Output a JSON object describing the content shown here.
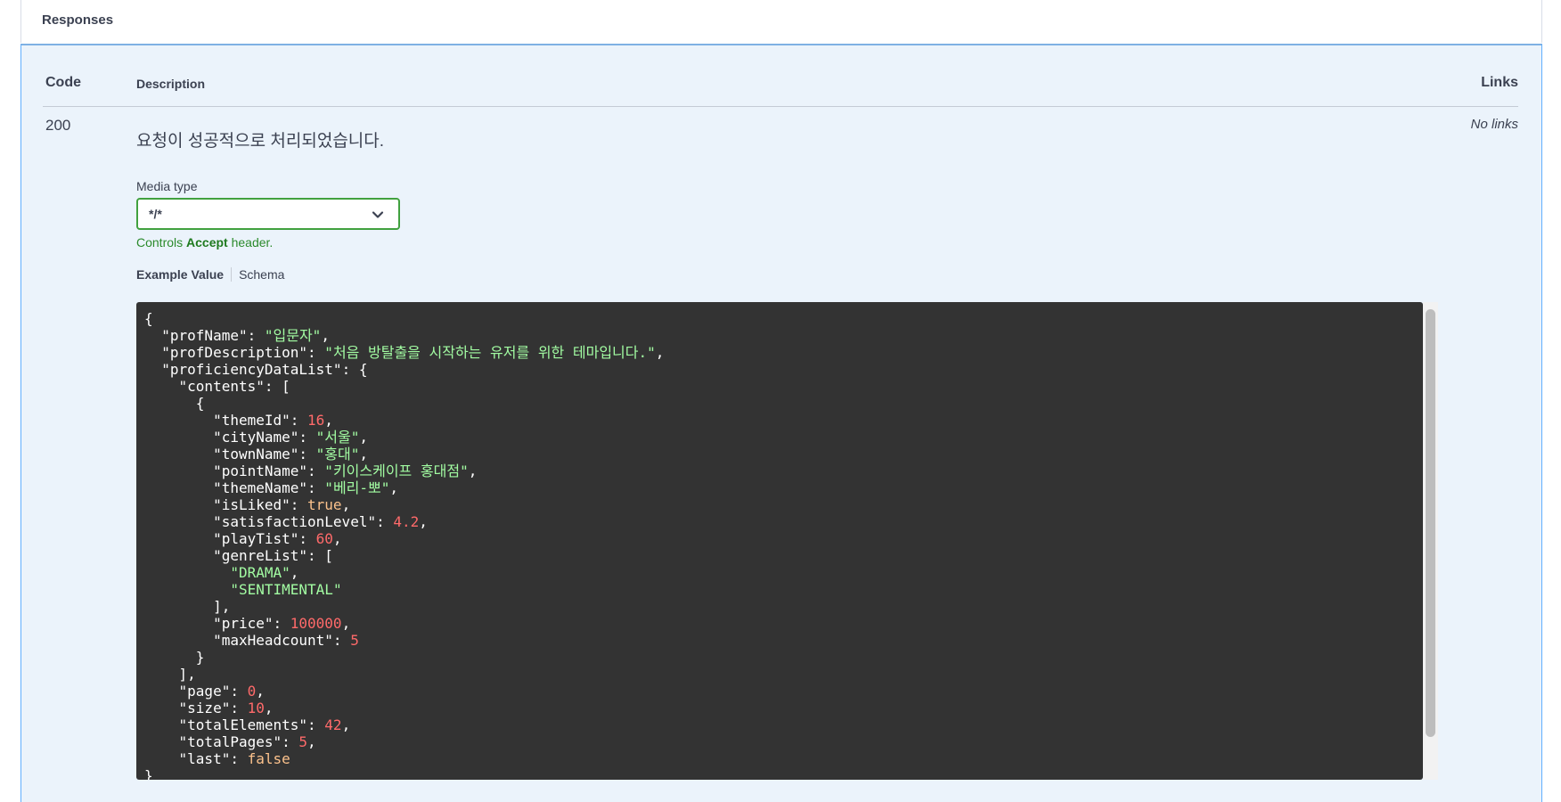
{
  "section": {
    "title": "Responses"
  },
  "table": {
    "headers": {
      "code": "Code",
      "description": "Description",
      "links": "Links"
    },
    "row": {
      "code": "200",
      "description": "요청이 성공적으로 처리되었습니다.",
      "links": "No links"
    }
  },
  "media": {
    "label": "Media type",
    "selected": "*/*",
    "note_prefix": "Controls ",
    "note_bold": "Accept",
    "note_suffix": " header."
  },
  "tabs": {
    "example": "Example Value",
    "schema": "Schema"
  },
  "example_json": {
    "profName": "입문자",
    "profDescription": "처음 방탈출을 시작하는 유저를 위한 테마입니다.",
    "themeId": "16",
    "cityName": "서울",
    "townName": "홍대",
    "pointName": "키이스케이프 홍대점",
    "themeName": "베리-뽀",
    "isLiked": "true",
    "satisfactionLevel": "4.2",
    "playTist": "60",
    "genre1": "DRAMA",
    "genre2": "SENTIMENTAL",
    "price": "100000",
    "maxHeadcount": "5",
    "page": "0",
    "size": "10",
    "totalElements": "42",
    "totalPages": "5",
    "last": "false"
  },
  "colors": {
    "accent": "#61affe",
    "select_border": "#41a13f",
    "code_bg": "#333333",
    "string": "#a2fca2",
    "number": "#ff6a6a",
    "boolean": "#fcc28c"
  }
}
